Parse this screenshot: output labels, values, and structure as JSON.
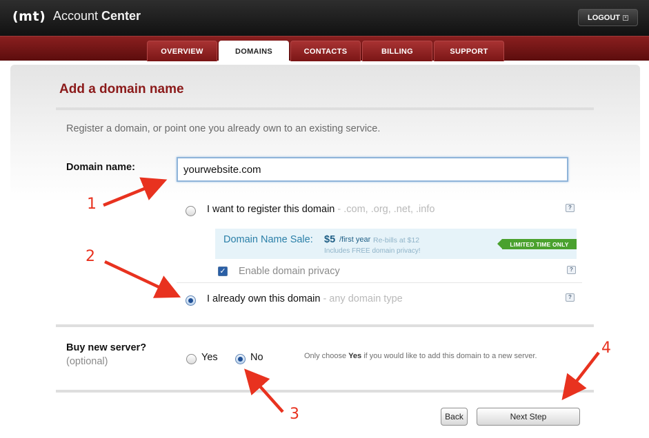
{
  "header": {
    "logo_text": "(mt)",
    "title_light": "Account ",
    "title_bold": "Center",
    "logout_label": "LOGOUT",
    "logout_icon": "close-box-icon"
  },
  "tabs": [
    {
      "label": "OVERVIEW",
      "active": false
    },
    {
      "label": "DOMAINS",
      "active": true
    },
    {
      "label": "CONTACTS",
      "active": false
    },
    {
      "label": "BILLING",
      "active": false
    },
    {
      "label": "SUPPORT",
      "active": false
    }
  ],
  "page": {
    "title": "Add a domain name",
    "intro": "Register a domain, or point one you already own to an existing service."
  },
  "domain": {
    "label": "Domain name:",
    "value": "yourwebsite.com"
  },
  "options": {
    "register": {
      "label": "I want to register this domain",
      "hint": " - .com, .org, .net, .info",
      "checked": false
    },
    "own": {
      "label": "I already own this domain",
      "hint": " - any domain type",
      "checked": true
    },
    "help_glyph": "?"
  },
  "sale": {
    "title": "Domain Name Sale:",
    "price": "$5",
    "per": "/first year",
    "rebill": "Re-bills at $12",
    "free_privacy": "Includes FREE domain privacy!",
    "badge": "LIMITED TIME ONLY"
  },
  "privacy": {
    "label": "Enable domain privacy",
    "checked": true,
    "check_glyph": "✓"
  },
  "server": {
    "label": "Buy new server?",
    "sublabel": "(optional)",
    "yes_label": "Yes",
    "no_label": "No",
    "selected": "No",
    "note_prefix": "Only choose ",
    "note_bold": "Yes",
    "note_suffix": " if you would like to add this domain to a new server."
  },
  "buttons": {
    "back": "Back",
    "next": "Next Step"
  },
  "annotations": {
    "color": "#e8321f",
    "numbers": [
      "1",
      "2",
      "3",
      "4"
    ]
  },
  "colors": {
    "brand_red": "#8b1a1a",
    "nav_red": "#7a1616",
    "sale_bg": "#e6f3f9",
    "badge_green": "#4aa12e"
  }
}
